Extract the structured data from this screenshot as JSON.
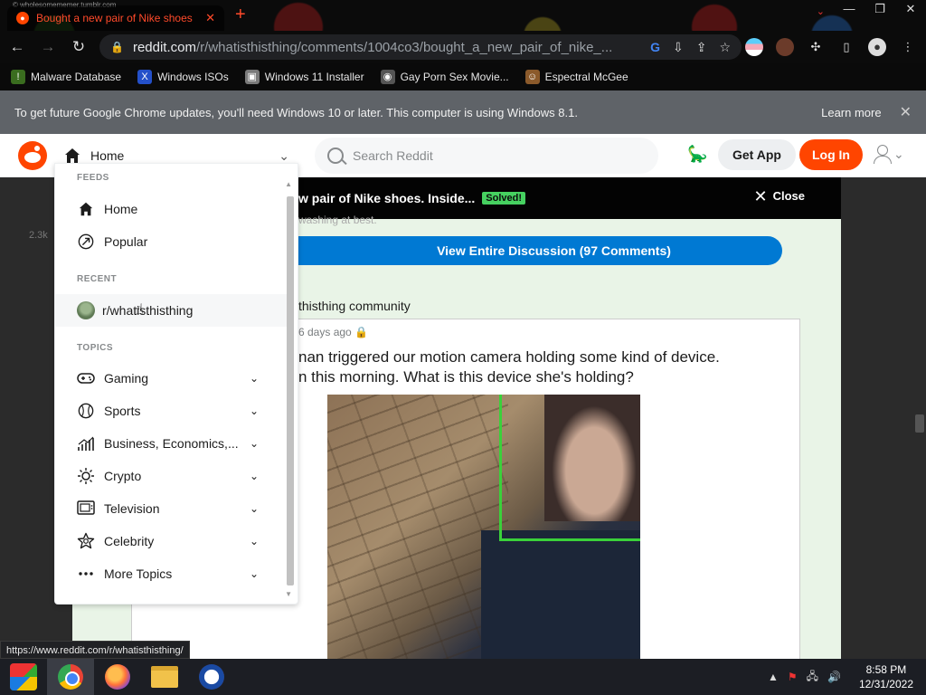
{
  "browser": {
    "tab_tiny_label": "© wholesomememer.tumblr.com",
    "tab_title": "Bought a new pair of Nike shoes",
    "tab_close": "✕",
    "new_tab": "+",
    "url_prefix": "reddit.com",
    "url_path": "/r/whatisthisthing/comments/1004co3/bought_a_new_pair_of_nike_...",
    "bookmarks": [
      {
        "label": "Malware Database",
        "icon": "warning-icon",
        "color": "#3a6d1f"
      },
      {
        "label": "Windows ISOs",
        "icon": "x-logo-icon",
        "color": "#2450c9"
      },
      {
        "label": "Windows 11 Installer",
        "icon": "image-icon",
        "color": "#7a7a7a"
      },
      {
        "label": "Gay Porn Sex Movie...",
        "icon": "globe-icon",
        "color": "#555555"
      },
      {
        "label": "Espectral McGee",
        "icon": "avatar-icon",
        "color": "#8b5a2b"
      }
    ]
  },
  "infobar": {
    "message": "To get future Google Chrome updates, you'll need Windows 10 or later. This computer is using Windows 8.1.",
    "learn_more": "Learn more"
  },
  "reddit_header": {
    "feed_selector_label": "Home",
    "search_placeholder": "Search Reddit",
    "get_app": "Get App",
    "login": "Log In"
  },
  "dropdown": {
    "feeds_heading": "FEEDS",
    "feeds": [
      {
        "label": "Home",
        "icon": "home-icon"
      },
      {
        "label": "Popular",
        "icon": "popular-icon"
      }
    ],
    "recent_heading": "RECENT",
    "recent": [
      {
        "label": "r/whatisthisthing",
        "icon": "subreddit-avatar"
      }
    ],
    "topics_heading": "TOPICS",
    "topics": [
      {
        "label": "Gaming",
        "icon": "gamepad-icon",
        "glyph": "🎮"
      },
      {
        "label": "Sports",
        "icon": "ball-icon",
        "glyph": "◍"
      },
      {
        "label": "Business, Economics,...",
        "icon": "chart-icon",
        "glyph": "📶"
      },
      {
        "label": "Crypto",
        "icon": "crypto-icon",
        "glyph": "✺"
      },
      {
        "label": "Television",
        "icon": "tv-icon",
        "glyph": "📺"
      },
      {
        "label": "Celebrity",
        "icon": "star-icon",
        "glyph": "☆"
      },
      {
        "label": "More Topics",
        "icon": "more-icon",
        "glyph": "···"
      }
    ]
  },
  "post": {
    "topbar_title": "w pair of Nike shoes. Inside...",
    "flair": "Solved!",
    "close_label": "Close",
    "washing_text": "washing at best.",
    "view_all": "View Entire Discussion (97 Comments)",
    "community": "thisthing community",
    "meta": "6 days ago 🔒",
    "title_line1": "nan triggered our motion camera holding some kind of device.",
    "title_line2": "n this morning. What is this device she's holding?",
    "vote_count": "2.3k"
  },
  "status_url": "https://www.reddit.com/r/whatisthisthing/",
  "taskbar": {
    "time": "8:58 PM",
    "date": "12/31/2022"
  }
}
